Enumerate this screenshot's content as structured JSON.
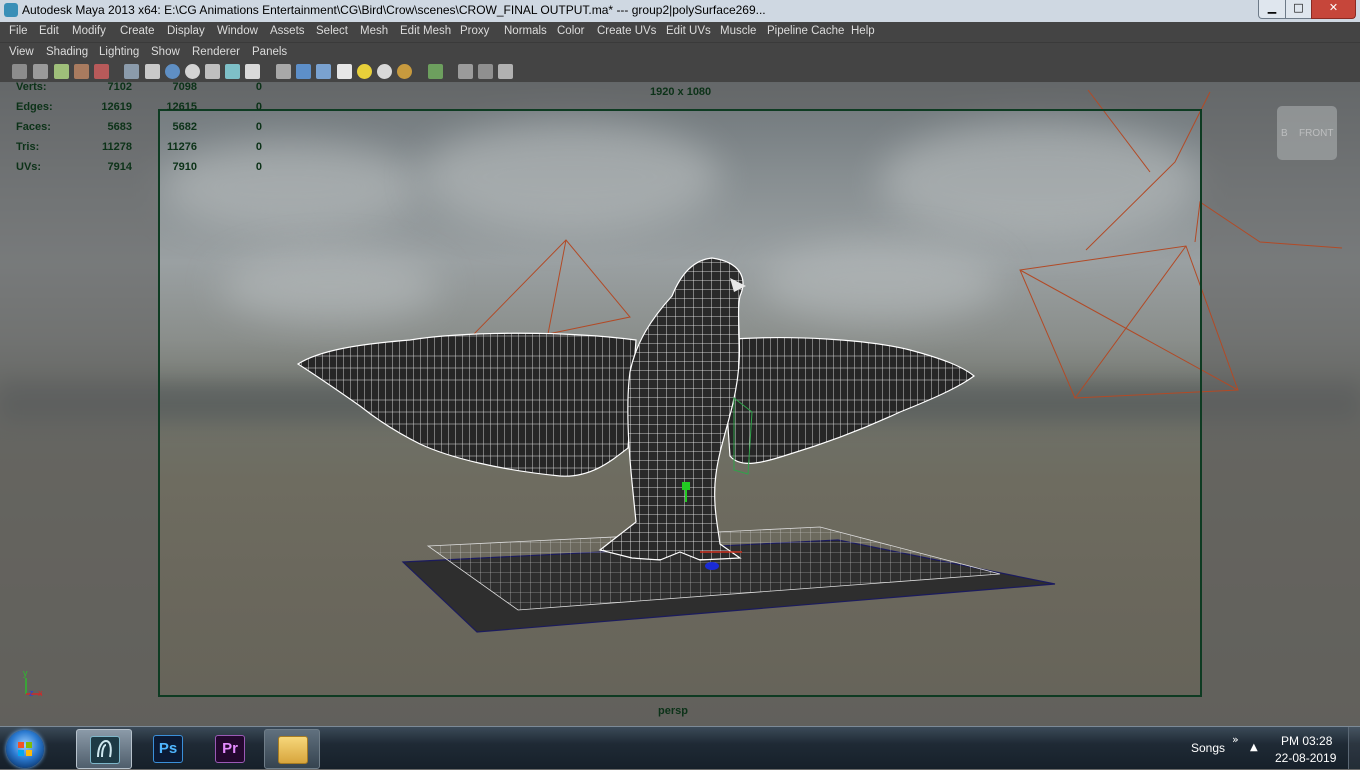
{
  "window": {
    "title": "Autodesk Maya 2013 x64: E:\\CG Animations Entertainment\\CG\\Bird\\Crow\\scenes\\CROW_FINAL OUTPUT.ma*   ---   group2|polySurface269...",
    "minimize_glyph": "▁",
    "maximize_glyph": "□",
    "close_glyph": "✕"
  },
  "menu": [
    "File",
    "Edit",
    "Modify",
    "Create",
    "Display",
    "Window",
    "Assets",
    "Select",
    "Mesh",
    "Edit Mesh",
    "Proxy",
    "Normals",
    "Color",
    "Create UVs",
    "Edit UVs",
    "Muscle",
    "Pipeline Cache",
    "Help"
  ],
  "panel_menu": [
    "View",
    "Shading",
    "Lighting",
    "Show",
    "Renderer",
    "Panels"
  ],
  "toolbar_icons": [
    "camera-select-icon",
    "camera-attributes-icon",
    "bookmark-icon",
    "image-plane-icon",
    "2d-pan-zoom-icon",
    "grid-icon",
    "film-gate-icon",
    "resolution-gate-icon",
    "gate-mask-icon",
    "field-chart-icon",
    "safe-action-icon",
    "safe-title-icon",
    "wireframe-icon",
    "smooth-shade-icon",
    "wireframe-on-shaded-icon",
    "textured-icon",
    "default-light-icon",
    "all-lights-icon",
    "shadows-icon",
    "isolate-select-icon",
    "xray-icon",
    "xray-joints-icon",
    "hardware-texturing-icon"
  ],
  "hud": {
    "rows": [
      {
        "label": "Verts:",
        "v1": "7102",
        "v2": "7098",
        "v3": "0"
      },
      {
        "label": "Edges:",
        "v1": "12619",
        "v2": "12615",
        "v3": "0"
      },
      {
        "label": "Faces:",
        "v1": "5683",
        "v2": "5682",
        "v3": "0"
      },
      {
        "label": "Tris:",
        "v1": "11278",
        "v2": "11276",
        "v3": "0"
      },
      {
        "label": "UVs:",
        "v1": "7914",
        "v2": "7910",
        "v3": "0"
      }
    ],
    "resolution": "1920 x 1080",
    "camera": "persp"
  },
  "viewcube": {
    "left_face": "B",
    "front_face": "FRONT"
  },
  "axis_labels": {
    "y": "y",
    "z": "z",
    "x": "x"
  },
  "colors": {
    "menu_bg": "#444444",
    "hud_text": "#0c3218",
    "wire": "#ffffff",
    "light_rig": "#b24a26"
  },
  "taskbar": {
    "apps": [
      {
        "name": "Maya",
        "label": ""
      },
      {
        "name": "Photoshop",
        "label": "Ps"
      },
      {
        "name": "Premiere",
        "label": "Pr"
      },
      {
        "name": "Explorer",
        "label": ""
      }
    ],
    "tray_label": "Songs",
    "tray_chevron": "»",
    "tray_arrow": "▲",
    "time": "PM 03:28",
    "date": "22-08-2019"
  }
}
